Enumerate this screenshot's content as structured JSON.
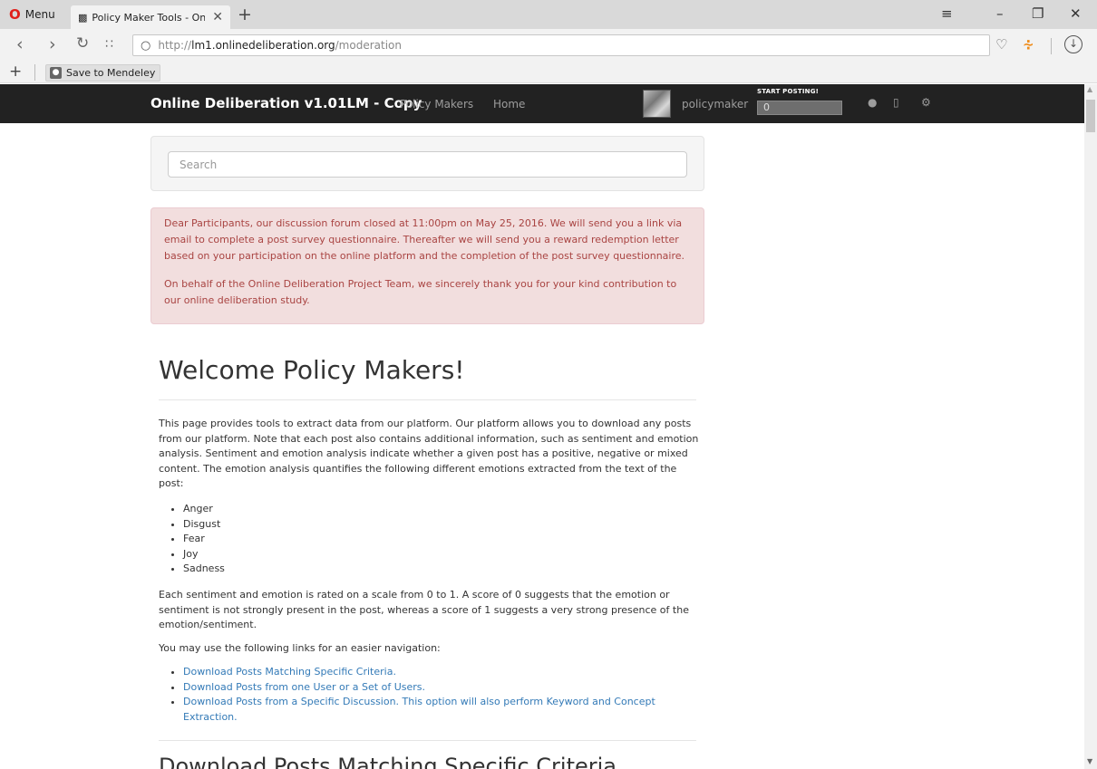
{
  "browser": {
    "menu_label": "Menu",
    "tab_title": "Policy Maker Tools - Online",
    "url_protocol": "http://",
    "url_host": "lm1.onlinedeliberation.org",
    "url_path": "/moderation",
    "bookmark": "Save to Mendeley"
  },
  "navbar": {
    "brand": "Online Deliberation v1.01LM - Copy",
    "links": [
      "Policy Makers",
      "Home"
    ],
    "username": "policymaker",
    "start_label": "START POSTING!",
    "start_value": "0"
  },
  "search": {
    "placeholder": "Search"
  },
  "alert": {
    "p1": "Dear Participants, our discussion forum closed at 11:00pm on May 25, 2016. We will send you a link via email to complete a post survey questionnaire. Thereafter we will send you a reward redemption letter based on your participation on the online platform and the completion of the post survey questionnaire.",
    "p2": "On behalf of the Online Deliberation Project Team, we sincerely thank you for your kind contribution to our online deliberation study."
  },
  "welcome": {
    "title": "Welcome Policy Makers!",
    "intro": "This page provides tools to extract data from our platform. Our platform allows you to download any posts from our platform. Note that each post also contains additional information, such as sentiment and emotion analysis. Sentiment and emotion analysis indicate whether a given post has a positive, negative or mixed content. The emotion analysis quantifies the following different emotions extracted from the text of the post:",
    "emotions": [
      "Anger",
      "Disgust",
      "Fear",
      "Joy",
      "Sadness"
    ],
    "scale_text": "Each sentiment and emotion is rated on a scale from 0 to 1. A score of 0 suggests that the emotion or sentiment is not strongly present in the post, whereas a score of 1 suggests a very strong presence of the emotion/sentiment.",
    "nav_text": "You may use the following links for an easier navigation:",
    "nav_links": [
      "Download Posts Matching Specific Criteria.",
      "Download Posts from one User or a Set of Users.",
      "Download Posts from a Specific Discussion. This option will also perform Keyword and Concept Extraction."
    ]
  },
  "section_title": "Download Posts Matching Specific Criteria"
}
